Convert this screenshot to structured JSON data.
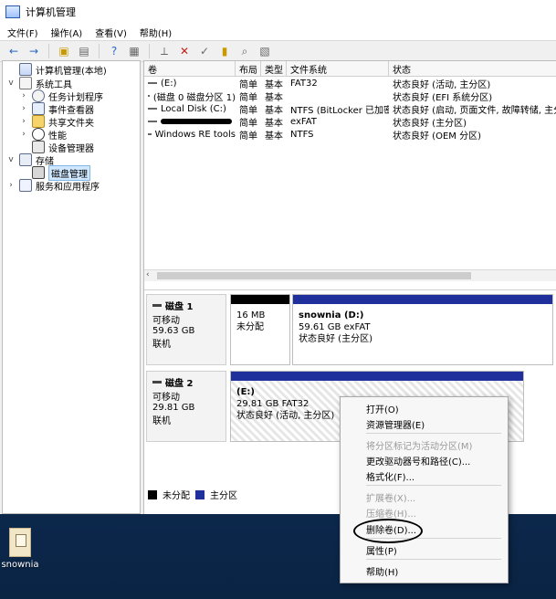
{
  "window": {
    "title": "计算机管理",
    "menu": [
      "文件(F)",
      "操作(A)",
      "查看(V)",
      "帮助(H)"
    ]
  },
  "tree": {
    "root": "计算机管理(本地)",
    "system_tools": "系统工具",
    "items": [
      "任务计划程序",
      "事件查看器",
      "共享文件夹",
      "性能",
      "设备管理器"
    ],
    "storage": "存储",
    "disk_mgmt": "磁盘管理",
    "services": "服务和应用程序"
  },
  "volume_list": {
    "headers": [
      "卷",
      "布局",
      "类型",
      "文件系统",
      "状态"
    ],
    "rows": [
      [
        "(E:)",
        "简单",
        "基本",
        "FAT32",
        "状态良好 (活动, 主分区)"
      ],
      [
        "(磁盘 0 磁盘分区 1)",
        "简单",
        "基本",
        "",
        "状态良好 (EFI 系统分区)"
      ],
      [
        "Local Disk (C:)",
        "简单",
        "基本",
        "NTFS (BitLocker 已加密)",
        "状态良好 (启动, 页面文件, 故障转储, 主分"
      ],
      [
        "",
        "简单",
        "基本",
        "exFAT",
        "状态良好 (主分区)"
      ],
      [
        "Windows RE tools",
        "简单",
        "基本",
        "NTFS",
        "状态良好 (OEM 分区)"
      ]
    ]
  },
  "disks": [
    {
      "name": "磁盘 1",
      "type": "可移动",
      "size": "59.63 GB",
      "state": "联机",
      "partitions": [
        {
          "title": "",
          "line1": "16 MB",
          "line2": "未分配"
        },
        {
          "title": "snownia  (D:)",
          "line1": "59.61 GB exFAT",
          "line2": "状态良好 (主分区)"
        }
      ]
    },
    {
      "name": "磁盘 2",
      "type": "可移动",
      "size": "29.81 GB",
      "state": "联机",
      "partitions": [
        {
          "title": "(E:)",
          "line1": "29.81 GB FAT32",
          "line2": "状态良好 (活动, 主分区)"
        }
      ]
    }
  ],
  "legend": [
    "未分配",
    "主分区"
  ],
  "context_menu": {
    "items": [
      {
        "label": "打开(O)",
        "enabled": true
      },
      {
        "label": "资源管理器(E)",
        "enabled": true
      },
      {
        "label": "将分区标记为活动分区(M)",
        "enabled": false
      },
      {
        "label": "更改驱动器号和路径(C)...",
        "enabled": true
      },
      {
        "label": "格式化(F)...",
        "enabled": true
      },
      {
        "label": "扩展卷(X)...",
        "enabled": false
      },
      {
        "label": "压缩卷(H)...",
        "enabled": false
      },
      {
        "label": "删除卷(D)...",
        "enabled": true
      },
      {
        "label": "属性(P)",
        "enabled": true
      },
      {
        "label": "帮助(H)",
        "enabled": true
      }
    ]
  },
  "desktop": {
    "icon_label": "snownia"
  },
  "colors": {
    "primary_partition": "#1f2f9b",
    "unallocated": "#000000",
    "selection": "#cfe7ff"
  }
}
